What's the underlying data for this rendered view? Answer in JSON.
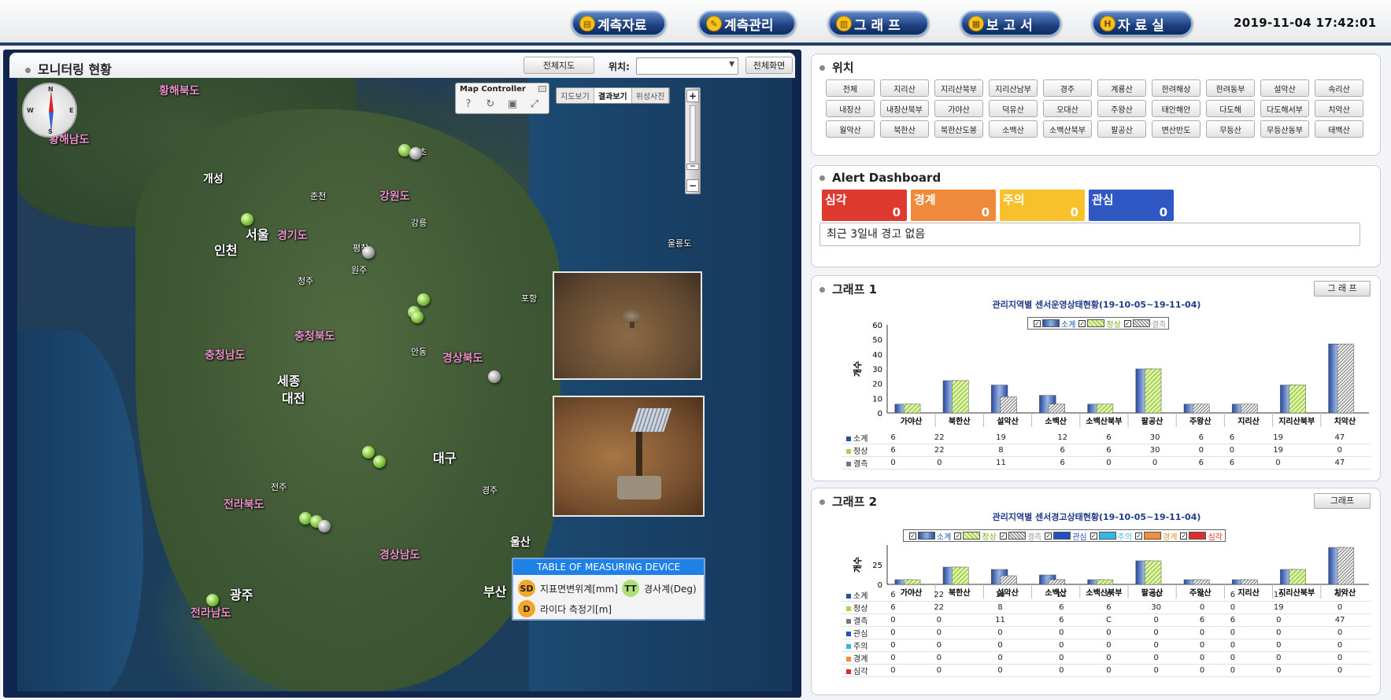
{
  "nav": {
    "items": [
      {
        "label": "계측자료",
        "icon": "chart-icon"
      },
      {
        "label": "계측관리",
        "icon": "wrench-icon"
      },
      {
        "label": "그 래 프",
        "icon": "graph-icon"
      },
      {
        "label": "보 고 서",
        "icon": "report-icon"
      },
      {
        "label": "자 료 실",
        "icon": "archive-icon"
      }
    ],
    "datetime": "2019-11-04  17:42:01"
  },
  "monitor": {
    "title": "모니터링 현황",
    "full_map_btn": "전체지도",
    "location_label": "위치:",
    "location_value": "",
    "fullscreen_btn": "전체화면"
  },
  "map": {
    "controller": {
      "title": "Map Controller",
      "icons": [
        "help-icon",
        "refresh-icon",
        "save-icon",
        "fit-icon"
      ]
    },
    "modes": [
      "지도보기",
      "결과보기",
      "위성사진"
    ],
    "active_mode": "결과보기",
    "zoom": {
      "plus": "+",
      "minus": "−"
    },
    "compass": {
      "n": "N",
      "s": "S",
      "e": "E",
      "w": "W"
    },
    "labels": [
      "황해북도",
      "황해남도",
      "개성",
      "강원도",
      "서울",
      "인천",
      "경기도",
      "충청남도",
      "충청북도",
      "세종",
      "대전",
      "전라북도",
      "경상북도",
      "대구",
      "경상남도",
      "전라남도",
      "광주",
      "울산",
      "부산",
      "평창",
      "강릉",
      "원주",
      "청주",
      "전주",
      "포항",
      "경주",
      "안동",
      "속초",
      "춘천",
      "울릉도"
    ],
    "legend": {
      "title": "TABLE OF MEASURING DEVICE",
      "items": [
        {
          "code": "SD",
          "label": "지표면변위계[mm]"
        },
        {
          "code": "TT",
          "label": "경사계(Deg)"
        },
        {
          "code": "D",
          "label": "라이다 측정기[m]"
        }
      ]
    }
  },
  "location": {
    "title": "위치",
    "buttons": [
      "전체",
      "지리산",
      "지리산북부",
      "지리산남부",
      "경주",
      "계룡산",
      "한려해상",
      "한려동부",
      "설악산",
      "속리산",
      "내장산",
      "내장산북부",
      "가야산",
      "덕유산",
      "오대산",
      "주왕산",
      "태안해안",
      "다도해",
      "다도해서부",
      "치악산",
      "월악산",
      "북한산",
      "북한산도봉",
      "소백산",
      "소백산북부",
      "팔공산",
      "변산반도",
      "무등산",
      "무등산동부",
      "태백산"
    ]
  },
  "alerts": {
    "title": "Alert Dashboard",
    "levels": [
      {
        "label": "심각",
        "value": "0",
        "color": "#df3a2f"
      },
      {
        "label": "경계",
        "value": "0",
        "color": "#ef8a3c"
      },
      {
        "label": "주의",
        "value": "0",
        "color": "#f8c12c"
      },
      {
        "label": "관심",
        "value": "0",
        "color": "#3058c4"
      }
    ],
    "message": "최근 3일내 경고 없음"
  },
  "graph1": {
    "title": "그래프 1",
    "button": "그 래 프",
    "button_raw": "그래프"
  },
  "graph2": {
    "title": "그래프 2",
    "button": "그래프"
  },
  "chart_data": [
    {
      "type": "bar",
      "title": "관리지역별 센서운영상태현황(19-10-05~19-11-04)",
      "ylabel": "개수",
      "ylim": [
        0,
        60
      ],
      "yticks": [
        0,
        10,
        20,
        30,
        40,
        50,
        60
      ],
      "categories": [
        "가야산",
        "북한산",
        "설악산",
        "소백산",
        "소백산북부",
        "팔공산",
        "주왕산",
        "지리산",
        "지리산북부",
        "치악산"
      ],
      "series": [
        {
          "name": "소계",
          "values": [
            6,
            22,
            19,
            12,
            6,
            30,
            6,
            6,
            19,
            47
          ]
        },
        {
          "name": "정상",
          "values": [
            6,
            22,
            8,
            6,
            6,
            30,
            0,
            0,
            19,
            0
          ]
        },
        {
          "name": "결측",
          "values": [
            0,
            0,
            11,
            6,
            0,
            0,
            6,
            6,
            0,
            47
          ]
        }
      ]
    },
    {
      "type": "bar",
      "title": "관리지역별 센서경고상태현황(19-10-05~19-11-04)",
      "ylabel": "개수",
      "ylim": [
        0,
        50
      ],
      "yticks": [
        0,
        25
      ],
      "categories": [
        "가야산",
        "북한산",
        "설악산",
        "소백산",
        "소백산북부",
        "팔공산",
        "주왕산",
        "지리산",
        "지리산북부",
        "치악산"
      ],
      "series": [
        {
          "name": "소계",
          "values": [
            6,
            22,
            19,
            12,
            6,
            30,
            6,
            6,
            19,
            47
          ]
        },
        {
          "name": "정상",
          "values": [
            6,
            22,
            8,
            6,
            6,
            30,
            0,
            0,
            19,
            0
          ]
        },
        {
          "name": "결측",
          "values": [
            0,
            0,
            11,
            6,
            "C",
            0,
            6,
            6,
            0,
            47
          ]
        },
        {
          "name": "관심",
          "values": [
            0,
            0,
            0,
            0,
            0,
            0,
            0,
            0,
            0,
            0
          ]
        },
        {
          "name": "주의",
          "values": [
            0,
            0,
            0,
            0,
            0,
            0,
            0,
            0,
            0,
            0
          ]
        },
        {
          "name": "경계",
          "values": [
            0,
            0,
            0,
            0,
            0,
            0,
            0,
            0,
            0,
            0
          ]
        },
        {
          "name": "심각",
          "values": [
            0,
            0,
            0,
            0,
            0,
            0,
            0,
            0,
            0,
            0
          ]
        }
      ]
    }
  ],
  "colors": {
    "navy": "#10264e",
    "accent": "#1f80e5",
    "so": "#2a4ea0",
    "jo": "#a7d44a",
    "gy": "#888888",
    "gw": "#1f52c0",
    "ju": "#36b6e8",
    "gye": "#f08c3a",
    "sim": "#e02c2c"
  }
}
